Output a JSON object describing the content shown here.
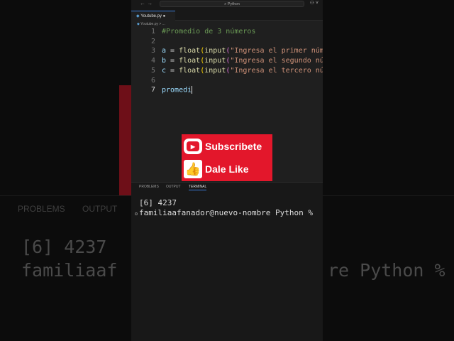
{
  "window": {
    "command_center": "Python",
    "tab_label": "Youtube.py",
    "breadcrumb": "Youtube.py > ...",
    "nav": "← →",
    "account": "⚇ ˅"
  },
  "code": [
    {
      "n": "1",
      "text": "#Promedio de 3 números"
    },
    {
      "n": "2",
      "text": ""
    },
    {
      "n": "3",
      "var": "a",
      "str": "\"Ingresa el primer número"
    },
    {
      "n": "4",
      "var": "b",
      "str": "\"Ingresa el segundo númer"
    },
    {
      "n": "5",
      "var": "c",
      "str": "\"Ingresa el tercero númer"
    },
    {
      "n": "6",
      "text": ""
    },
    {
      "n": "7",
      "text": "promedi"
    }
  ],
  "tokens": {
    "eq": " = ",
    "float": "float",
    "input": "input",
    "p1": "(",
    "p2": "("
  },
  "overlay": {
    "subscribe": "Subscribete",
    "like": "Dale Like"
  },
  "panel": {
    "tabs": [
      "PROBLEMS",
      "OUTPUT",
      "TERMINAL"
    ]
  },
  "terminal": {
    "line1": "[6] 4237",
    "line2": "familiaafanador@nuevo-nombre Python %"
  },
  "background": {
    "tabs": [
      "PROBLEMS",
      "OUTPUT"
    ],
    "line1": "[6] 4237",
    "line2_left": "familiaaf",
    "line2_right": "re Python %"
  }
}
